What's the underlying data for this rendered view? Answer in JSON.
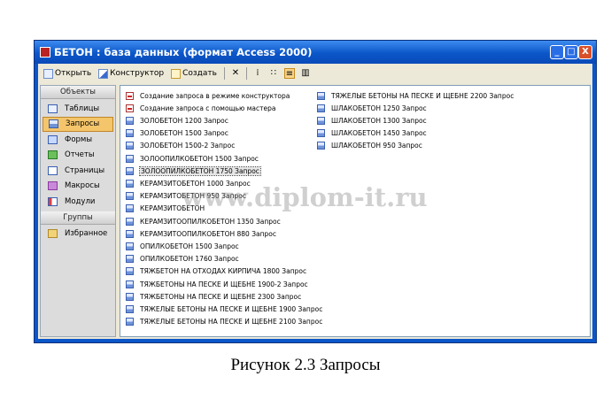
{
  "window": {
    "title": "БЕТОН : база данных (формат Access 2000)",
    "buttons": [
      "_",
      "□",
      "X"
    ]
  },
  "toolbar": {
    "open_label": "Открыть",
    "design_label": "Конструктор",
    "create_label": "Создать"
  },
  "sidebar": {
    "objects_header": "Объекты",
    "items": [
      {
        "label": "Таблицы",
        "icon": "table-icon"
      },
      {
        "label": "Запросы",
        "icon": "query-icon",
        "selected": true
      },
      {
        "label": "Формы",
        "icon": "form-icon"
      },
      {
        "label": "Отчеты",
        "icon": "report-icon"
      },
      {
        "label": "Страницы",
        "icon": "page-icon"
      },
      {
        "label": "Макросы",
        "icon": "macro-icon"
      },
      {
        "label": "Модули",
        "icon": "module-icon"
      }
    ],
    "groups_header": "Группы",
    "groups": [
      {
        "label": "Избранное",
        "icon": "folder-icon"
      }
    ]
  },
  "queries": {
    "col1": [
      {
        "label": "Создание запроса в режиме конструктора",
        "icon": "wizard"
      },
      {
        "label": "Создание запроса с помощью мастера",
        "icon": "wizard"
      },
      {
        "label": "ЗОЛОБЕТОН 1200 Запрос",
        "icon": "query"
      },
      {
        "label": "ЗОЛОБЕТОН 1500 Запрос",
        "icon": "query"
      },
      {
        "label": "ЗОЛОБЕТОН 1500-2 Запрос",
        "icon": "query"
      },
      {
        "label": "ЗОЛООПИЛКОБЕТОН 1500 Запрос",
        "icon": "query"
      },
      {
        "label": "ЗОЛООПИЛКОБЕТОН 1750 Запрос",
        "icon": "query",
        "selected": true
      },
      {
        "label": "КЕРАМЗИТОБЕТОН 1000 Запрос",
        "icon": "query"
      },
      {
        "label": "КЕРАМЗИТОБЕТОН 950 Запрос",
        "icon": "query"
      },
      {
        "label": "КЕРАМЗИТОБЕТОН",
        "icon": "query"
      },
      {
        "label": "КЕРАМЗИТООПИЛКОБЕТОН 1350 Запрос",
        "icon": "query"
      },
      {
        "label": "КЕРАМЗИТООПИЛКОБЕТОН 880 Запрос",
        "icon": "query"
      },
      {
        "label": "ОПИЛКОБЕТОН 1500 Запрос",
        "icon": "query"
      },
      {
        "label": "ОПИЛКОБЕТОН 1760 Запрос",
        "icon": "query"
      },
      {
        "label": "ТЯЖБЕТОН  НА ОТХОДАХ КИРПИЧА 1800 Запрос",
        "icon": "query"
      },
      {
        "label": "ТЯЖБЕТОНЫ  НА ПЕСКЕ И ЩЕБНЕ 1900-2 Запрос",
        "icon": "query"
      },
      {
        "label": "ТЯЖБЕТОНЫ  НА ПЕСКЕ И ЩЕБНЕ 2300 Запрос",
        "icon": "query"
      },
      {
        "label": "ТЯЖЕЛЫЕ БЕТОНЫ  НА ПЕСКЕ И ЩЕБНЕ 1900 Запрос",
        "icon": "query"
      },
      {
        "label": "ТЯЖЕЛЫЕ БЕТОНЫ  НА ПЕСКЕ И ЩЕБНЕ 2100 Запрос",
        "icon": "query"
      }
    ],
    "col2": [
      {
        "label": "ТЯЖЕЛЫЕ БЕТОНЫ  НА ПЕСКЕ И ЩЕБНЕ 2200 Запрос",
        "icon": "query"
      },
      {
        "label": "ШЛАКОБЕТОН 1250 Запрос",
        "icon": "query"
      },
      {
        "label": "ШЛАКОБЕТОН 1300 Запрос",
        "icon": "query"
      },
      {
        "label": "ШЛАКОБЕТОН 1450 Запрос",
        "icon": "query"
      },
      {
        "label": "ШЛАКОБЕТОН 950 Запрос",
        "icon": "query"
      }
    ]
  },
  "watermark": "www.diplom-it.ru",
  "caption": "Рисунок 2.3 Запросы"
}
